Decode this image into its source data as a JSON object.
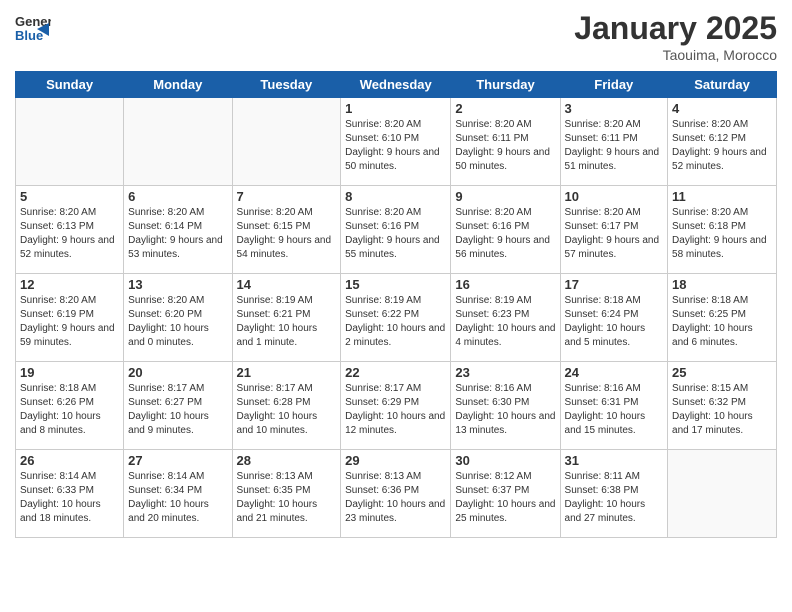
{
  "logo": {
    "general": "General",
    "blue": "Blue"
  },
  "title": "January 2025",
  "location": "Taouima, Morocco",
  "weekdays": [
    "Sunday",
    "Monday",
    "Tuesday",
    "Wednesday",
    "Thursday",
    "Friday",
    "Saturday"
  ],
  "weeks": [
    [
      {
        "day": "",
        "info": ""
      },
      {
        "day": "",
        "info": ""
      },
      {
        "day": "",
        "info": ""
      },
      {
        "day": "1",
        "info": "Sunrise: 8:20 AM\nSunset: 6:10 PM\nDaylight: 9 hours\nand 50 minutes."
      },
      {
        "day": "2",
        "info": "Sunrise: 8:20 AM\nSunset: 6:11 PM\nDaylight: 9 hours\nand 50 minutes."
      },
      {
        "day": "3",
        "info": "Sunrise: 8:20 AM\nSunset: 6:11 PM\nDaylight: 9 hours\nand 51 minutes."
      },
      {
        "day": "4",
        "info": "Sunrise: 8:20 AM\nSunset: 6:12 PM\nDaylight: 9 hours\nand 52 minutes."
      }
    ],
    [
      {
        "day": "5",
        "info": "Sunrise: 8:20 AM\nSunset: 6:13 PM\nDaylight: 9 hours\nand 52 minutes."
      },
      {
        "day": "6",
        "info": "Sunrise: 8:20 AM\nSunset: 6:14 PM\nDaylight: 9 hours\nand 53 minutes."
      },
      {
        "day": "7",
        "info": "Sunrise: 8:20 AM\nSunset: 6:15 PM\nDaylight: 9 hours\nand 54 minutes."
      },
      {
        "day": "8",
        "info": "Sunrise: 8:20 AM\nSunset: 6:16 PM\nDaylight: 9 hours\nand 55 minutes."
      },
      {
        "day": "9",
        "info": "Sunrise: 8:20 AM\nSunset: 6:16 PM\nDaylight: 9 hours\nand 56 minutes."
      },
      {
        "day": "10",
        "info": "Sunrise: 8:20 AM\nSunset: 6:17 PM\nDaylight: 9 hours\nand 57 minutes."
      },
      {
        "day": "11",
        "info": "Sunrise: 8:20 AM\nSunset: 6:18 PM\nDaylight: 9 hours\nand 58 minutes."
      }
    ],
    [
      {
        "day": "12",
        "info": "Sunrise: 8:20 AM\nSunset: 6:19 PM\nDaylight: 9 hours\nand 59 minutes."
      },
      {
        "day": "13",
        "info": "Sunrise: 8:20 AM\nSunset: 6:20 PM\nDaylight: 10 hours\nand 0 minutes."
      },
      {
        "day": "14",
        "info": "Sunrise: 8:19 AM\nSunset: 6:21 PM\nDaylight: 10 hours\nand 1 minute."
      },
      {
        "day": "15",
        "info": "Sunrise: 8:19 AM\nSunset: 6:22 PM\nDaylight: 10 hours\nand 2 minutes."
      },
      {
        "day": "16",
        "info": "Sunrise: 8:19 AM\nSunset: 6:23 PM\nDaylight: 10 hours\nand 4 minutes."
      },
      {
        "day": "17",
        "info": "Sunrise: 8:18 AM\nSunset: 6:24 PM\nDaylight: 10 hours\nand 5 minutes."
      },
      {
        "day": "18",
        "info": "Sunrise: 8:18 AM\nSunset: 6:25 PM\nDaylight: 10 hours\nand 6 minutes."
      }
    ],
    [
      {
        "day": "19",
        "info": "Sunrise: 8:18 AM\nSunset: 6:26 PM\nDaylight: 10 hours\nand 8 minutes."
      },
      {
        "day": "20",
        "info": "Sunrise: 8:17 AM\nSunset: 6:27 PM\nDaylight: 10 hours\nand 9 minutes."
      },
      {
        "day": "21",
        "info": "Sunrise: 8:17 AM\nSunset: 6:28 PM\nDaylight: 10 hours\nand 10 minutes."
      },
      {
        "day": "22",
        "info": "Sunrise: 8:17 AM\nSunset: 6:29 PM\nDaylight: 10 hours\nand 12 minutes."
      },
      {
        "day": "23",
        "info": "Sunrise: 8:16 AM\nSunset: 6:30 PM\nDaylight: 10 hours\nand 13 minutes."
      },
      {
        "day": "24",
        "info": "Sunrise: 8:16 AM\nSunset: 6:31 PM\nDaylight: 10 hours\nand 15 minutes."
      },
      {
        "day": "25",
        "info": "Sunrise: 8:15 AM\nSunset: 6:32 PM\nDaylight: 10 hours\nand 17 minutes."
      }
    ],
    [
      {
        "day": "26",
        "info": "Sunrise: 8:14 AM\nSunset: 6:33 PM\nDaylight: 10 hours\nand 18 minutes."
      },
      {
        "day": "27",
        "info": "Sunrise: 8:14 AM\nSunset: 6:34 PM\nDaylight: 10 hours\nand 20 minutes."
      },
      {
        "day": "28",
        "info": "Sunrise: 8:13 AM\nSunset: 6:35 PM\nDaylight: 10 hours\nand 21 minutes."
      },
      {
        "day": "29",
        "info": "Sunrise: 8:13 AM\nSunset: 6:36 PM\nDaylight: 10 hours\nand 23 minutes."
      },
      {
        "day": "30",
        "info": "Sunrise: 8:12 AM\nSunset: 6:37 PM\nDaylight: 10 hours\nand 25 minutes."
      },
      {
        "day": "31",
        "info": "Sunrise: 8:11 AM\nSunset: 6:38 PM\nDaylight: 10 hours\nand 27 minutes."
      },
      {
        "day": "",
        "info": ""
      }
    ]
  ]
}
